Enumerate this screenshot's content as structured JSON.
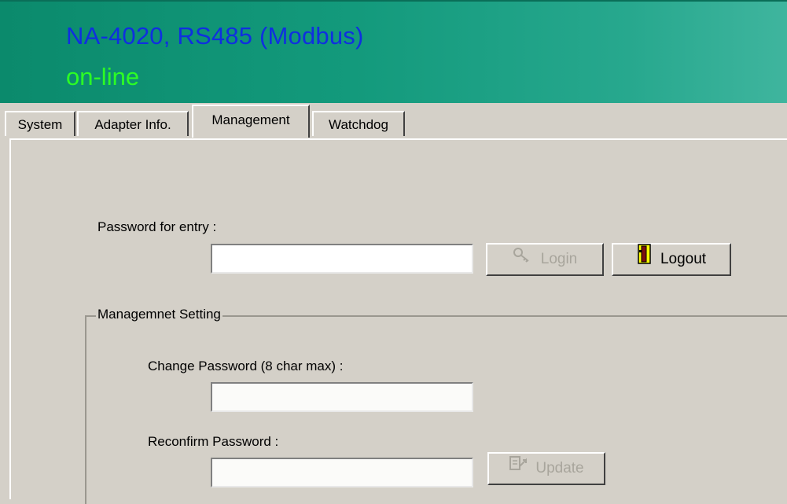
{
  "header": {
    "title": "NA-4020, RS485 (Modbus)",
    "status": "on-line",
    "title_color": "#0f2fe0",
    "status_color": "#2cff24"
  },
  "tabs": [
    {
      "label": "System"
    },
    {
      "label": "Adapter Info."
    },
    {
      "label": "Management"
    },
    {
      "label": "Watchdog"
    }
  ],
  "active_tab": "Management",
  "login": {
    "password_label": "Password for entry :",
    "password_value": "",
    "login_label": "Login",
    "logout_label": "Logout",
    "login_icon": "key-icon",
    "logout_icon": "door-exit-icon"
  },
  "management": {
    "group_label": "Managemnet Setting",
    "change_label": "Change Password (8 char max) :",
    "change_value": "",
    "reconfirm_label": "Reconfirm Password :",
    "reconfirm_value": "",
    "update_label": "Update",
    "update_icon": "update-icon"
  }
}
